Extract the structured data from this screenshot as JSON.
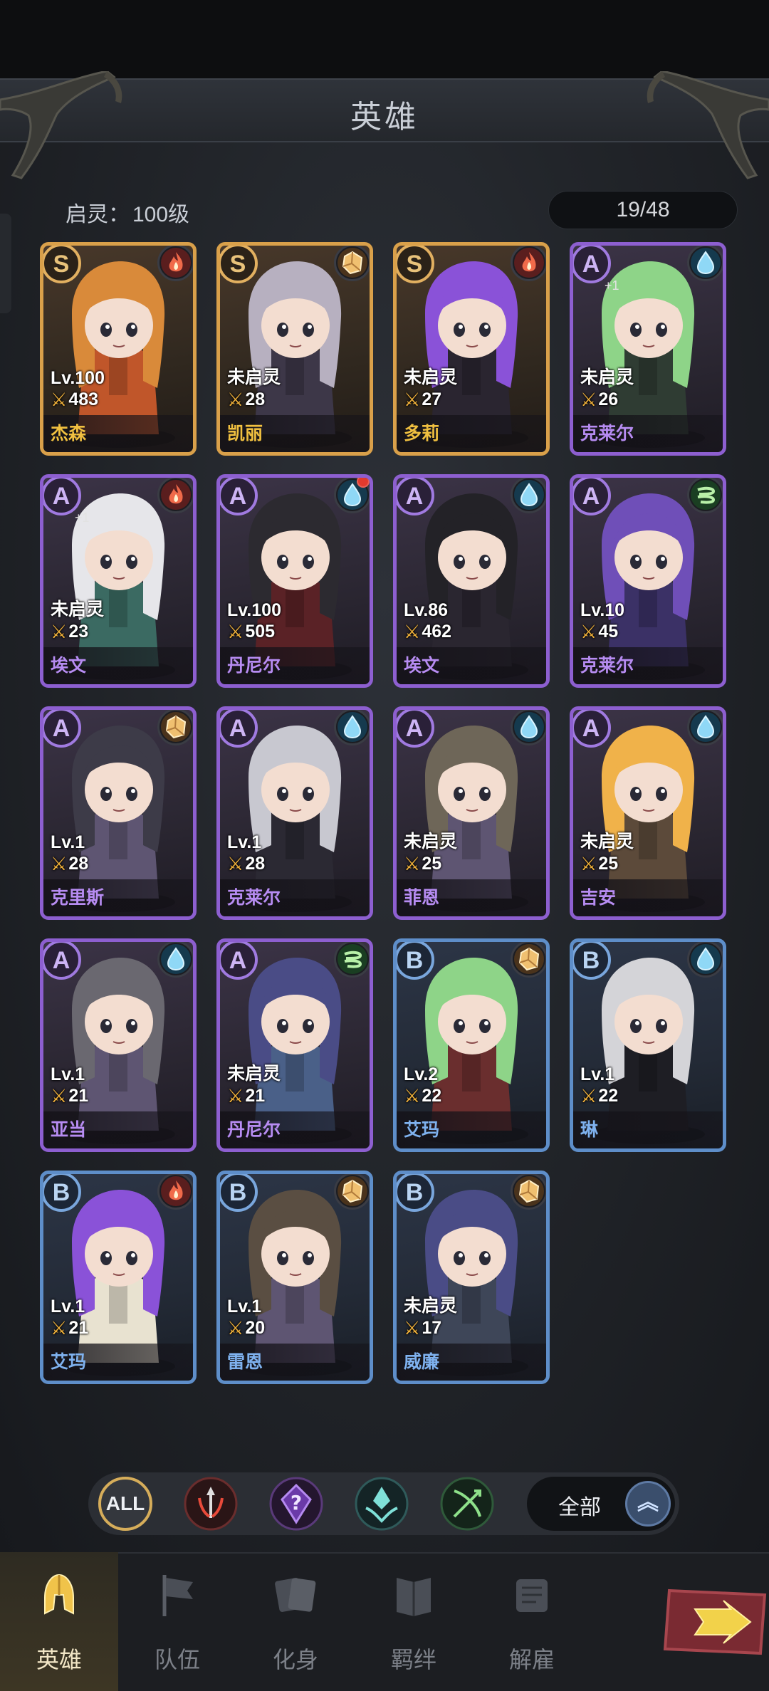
{
  "header": {
    "title": "英雄"
  },
  "status": {
    "lock_label": "启灵：",
    "lock_value": "100级",
    "hero_count": "19/48"
  },
  "colors": {
    "S": "#d9a04a",
    "A": "#8d5fd0",
    "B": "#5e8ec9",
    "fire": "#e04a38",
    "water": "#5ec0e8",
    "earth": "#e0a860",
    "wind": "#5cc86a"
  },
  "heroes": [
    {
      "rank": "S",
      "element": "fire",
      "level": "Lv.100",
      "power": "483",
      "name": "杰森",
      "plus": "",
      "dot": false,
      "hair": "#d98a3a",
      "cloak": "#c0562a"
    },
    {
      "rank": "S",
      "element": "earth",
      "level": "未启灵",
      "power": "28",
      "name": "凯丽",
      "plus": "",
      "dot": false,
      "hair": "#b7b0c0",
      "cloak": "#3d3748"
    },
    {
      "rank": "S",
      "element": "fire",
      "level": "未启灵",
      "power": "27",
      "name": "多莉",
      "plus": "",
      "dot": false,
      "hair": "#8a52d8",
      "cloak": "#2a2530"
    },
    {
      "rank": "A",
      "element": "water",
      "level": "未启灵",
      "power": "26",
      "name": "克莱尔",
      "plus": "+1",
      "dot": false,
      "hair": "#8ed488",
      "cloak": "#2f3c33"
    },
    {
      "rank": "A",
      "element": "fire",
      "level": "未启灵",
      "power": "23",
      "name": "埃文",
      "plus": "+1",
      "dot": false,
      "hair": "#e6e6ea",
      "cloak": "#3b6a62"
    },
    {
      "rank": "A",
      "element": "water",
      "level": "Lv.100",
      "power": "505",
      "name": "丹尼尔",
      "plus": "",
      "dot": true,
      "hair": "#2c2a30",
      "cloak": "#5a2226"
    },
    {
      "rank": "A",
      "element": "water",
      "level": "Lv.86",
      "power": "462",
      "name": "埃文",
      "plus": "",
      "dot": false,
      "hair": "#232227",
      "cloak": "#2a2630"
    },
    {
      "rank": "A",
      "element": "wind",
      "level": "Lv.10",
      "power": "45",
      "name": "克莱尔",
      "plus": "",
      "dot": false,
      "hair": "#6f4fb8",
      "cloak": "#3b3166"
    },
    {
      "rank": "A",
      "element": "earth",
      "level": "Lv.1",
      "power": "28",
      "name": "克里斯",
      "plus": "",
      "dot": false,
      "hair": "#3d3b48",
      "cloak": "#5e5572"
    },
    {
      "rank": "A",
      "element": "water",
      "level": "Lv.1",
      "power": "28",
      "name": "克莱尔",
      "plus": "",
      "dot": false,
      "hair": "#c8c8d0",
      "cloak": "#2b2933"
    },
    {
      "rank": "A",
      "element": "water",
      "level": "未启灵",
      "power": "25",
      "name": "菲恩",
      "plus": "",
      "dot": false,
      "hair": "#6e6658",
      "cloak": "#5e5572"
    },
    {
      "rank": "A",
      "element": "water",
      "level": "未启灵",
      "power": "25",
      "name": "吉安",
      "plus": "",
      "dot": false,
      "hair": "#f0b24a",
      "cloak": "#5c4a3a"
    },
    {
      "rank": "A",
      "element": "water",
      "level": "Lv.1",
      "power": "21",
      "name": "亚当",
      "plus": "",
      "dot": false,
      "hair": "#6a6870",
      "cloak": "#5e5572"
    },
    {
      "rank": "A",
      "element": "wind",
      "level": "未启灵",
      "power": "21",
      "name": "丹尼尔",
      "plus": "",
      "dot": false,
      "hair": "#4a4c86",
      "cloak": "#4a6088"
    },
    {
      "rank": "B",
      "element": "earth",
      "level": "Lv.2",
      "power": "22",
      "name": "艾玛",
      "plus": "",
      "dot": false,
      "hair": "#8ed488",
      "cloak": "#6a2e2e"
    },
    {
      "rank": "B",
      "element": "water",
      "level": "Lv.1",
      "power": "22",
      "name": "琳",
      "plus": "",
      "dot": false,
      "hair": "#d4d4d8",
      "cloak": "#1e1e24"
    },
    {
      "rank": "B",
      "element": "fire",
      "level": "Lv.1",
      "power": "21",
      "name": "艾玛",
      "plus": "",
      "dot": false,
      "hair": "#8a52d8",
      "cloak": "#e8e2d0"
    },
    {
      "rank": "B",
      "element": "earth",
      "level": "Lv.1",
      "power": "20",
      "name": "雷恩",
      "plus": "",
      "dot": false,
      "hair": "#5a4e42",
      "cloak": "#5e5572"
    },
    {
      "rank": "B",
      "element": "earth",
      "level": "未启灵",
      "power": "17",
      "name": "威廉",
      "plus": "",
      "dot": false,
      "hair": "#4a4c86",
      "cloak": "#3e4658"
    }
  ],
  "filters": {
    "all_label": "ALL",
    "items": [
      "warrior-icon",
      "mystic-icon",
      "support-icon",
      "ranger-icon"
    ],
    "sort_label": "全部"
  },
  "nav": [
    {
      "label": "英雄",
      "icon": "helmet-icon",
      "active": true
    },
    {
      "label": "队伍",
      "icon": "flag-icon",
      "active": false
    },
    {
      "label": "化身",
      "icon": "cards-icon",
      "active": false
    },
    {
      "label": "羁绊",
      "icon": "book-icon",
      "active": false
    },
    {
      "label": "解雇",
      "icon": "scroll-icon",
      "active": false
    }
  ]
}
